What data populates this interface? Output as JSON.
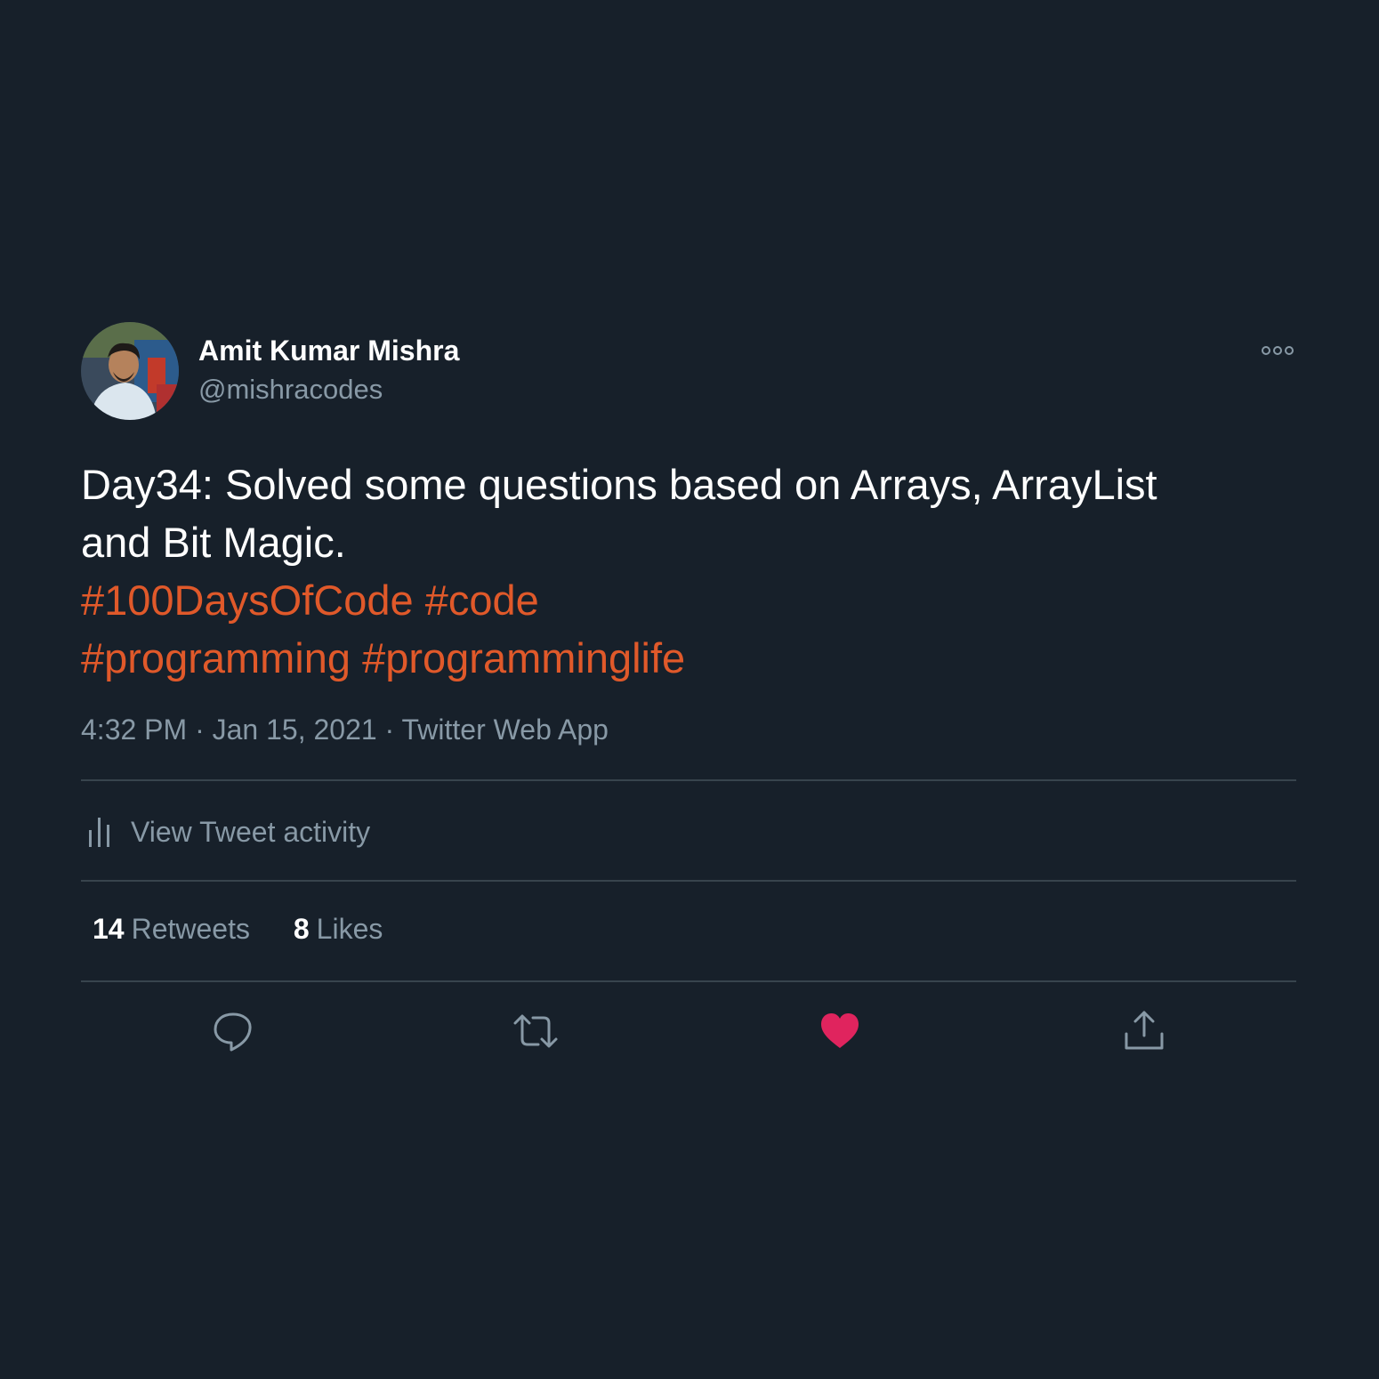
{
  "author": {
    "display_name": "Amit Kumar Mishra",
    "handle": "@mishracodes",
    "avatar_icon": "profile-photo"
  },
  "tweet": {
    "text_line_1": "Day34: Solved some questions based on  Arrays, ArrayList",
    "text_line_2": "and Bit Magic.",
    "hashtags_line_1": [
      "#100DaysOfCode",
      "#code"
    ],
    "hashtags_line_2": [
      "#programming",
      "#programminglife"
    ],
    "time": "4:32 PM",
    "separator": "·",
    "date": "Jan 15, 2021",
    "source": "Twitter Web App"
  },
  "activity": {
    "label": "View Tweet activity",
    "icon": "bar-chart-icon"
  },
  "stats": {
    "retweets_count": "14",
    "retweets_label": "Retweets",
    "likes_count": "8",
    "likes_label": "Likes"
  },
  "actions": {
    "reply_icon": "reply-icon",
    "retweet_icon": "retweet-icon",
    "like_icon": "heart-icon",
    "share_icon": "share-icon",
    "liked_color": "#e0245e"
  },
  "colors": {
    "background": "#17202a",
    "text": "#ffffff",
    "secondary": "#8899a6",
    "hashtag": "#e0592a",
    "divider": "#38444d"
  }
}
